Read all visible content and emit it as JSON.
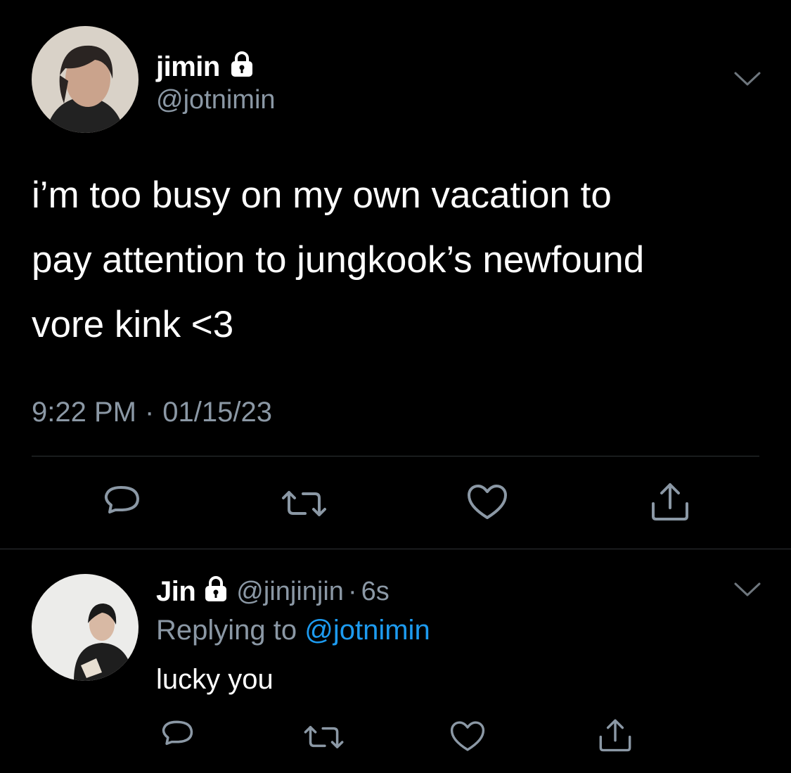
{
  "main_tweet": {
    "display_name": "jimin",
    "handle": "@jotnimin",
    "text_lines": [
      "i’m too busy on my own vacation to",
      "pay attention to jungkook’s newfound",
      "vore kink <3"
    ],
    "time": "9:22 PM",
    "separator": "·",
    "date": "01/15/23",
    "icons": {
      "avatar": "avatar-photo",
      "lock": "lock-icon",
      "menu": "chevron-down-icon",
      "reply": "reply-icon",
      "retweet": "retweet-icon",
      "like": "heart-icon",
      "share": "share-icon"
    }
  },
  "reply_tweet": {
    "display_name": "Jin",
    "handle": "@jinjinjin",
    "separator": "·",
    "age": "6s",
    "replying_prefix": "Replying to",
    "replying_handle": "@jotnimin",
    "text": "lucky you"
  },
  "colors": {
    "background": "#000000",
    "secondary_text": "#8b98a5",
    "link": "#1d9bf0",
    "divider": "#2f3336"
  }
}
